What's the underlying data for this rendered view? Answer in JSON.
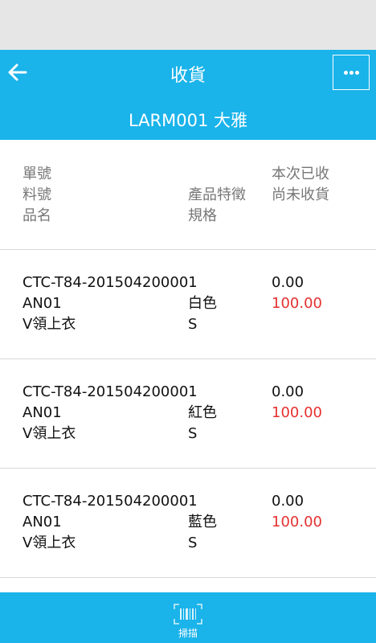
{
  "header": {
    "title": "收貨",
    "subtitle": "LARM001 大雅"
  },
  "columns": {
    "order_no": "單號",
    "item_no": "料號",
    "product_name": "品名",
    "feature": "產品特徵",
    "spec": "規格",
    "received": "本次已收",
    "pending": "尚未收貨"
  },
  "rows": [
    {
      "order_no": "CTC-T84-201504200001",
      "received": "0.00",
      "item_no": "AN01",
      "feature": "白色",
      "pending": "100.00",
      "product_name": "V領上衣",
      "spec": "S"
    },
    {
      "order_no": "CTC-T84-201504200001",
      "received": "0.00",
      "item_no": "AN01",
      "feature": "紅色",
      "pending": "100.00",
      "product_name": "V領上衣",
      "spec": "S"
    },
    {
      "order_no": "CTC-T84-201504200001",
      "received": "0.00",
      "item_no": "AN01",
      "feature": "藍色",
      "pending": "100.00",
      "product_name": "V領上衣",
      "spec": "S"
    }
  ],
  "bottom": {
    "scan_label": "掃描"
  },
  "colors": {
    "accent": "#1ab3ea",
    "pending": "#e53030"
  },
  "icons": {
    "back": "arrow-left-icon",
    "more": "more-dots-icon",
    "scan": "barcode-icon"
  }
}
